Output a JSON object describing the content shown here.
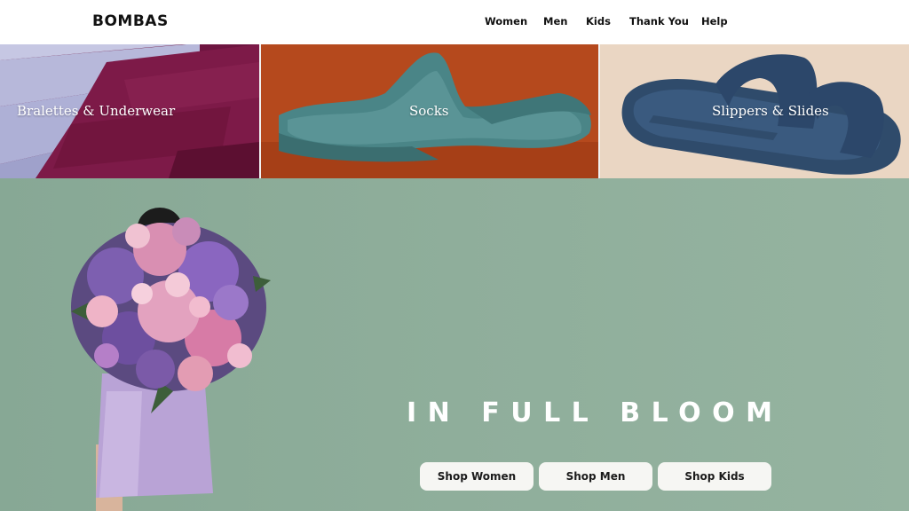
{
  "brand": {
    "logo": "BOMBAS"
  },
  "nav": {
    "items": [
      "Women",
      "Men",
      "Kids",
      "Thank You",
      "Help"
    ]
  },
  "categories": [
    {
      "label": "Bralettes & Underwear"
    },
    {
      "label": "Socks"
    },
    {
      "label": "Slippers & Slides"
    }
  ],
  "hero": {
    "title": "IN FULL BLOOM",
    "buttons": [
      "Shop Women",
      "Shop Men",
      "Shop Kids"
    ]
  },
  "colors": {
    "hero_bg": "#8fae9b",
    "button_bg": "#f6f6f3",
    "underwear_tile": "#7a1a45",
    "socks_tile": "#b14d22",
    "slides_tile": "#e9d3bf"
  }
}
